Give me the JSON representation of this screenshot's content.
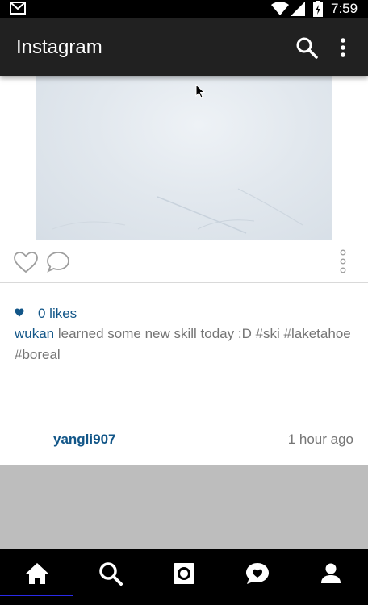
{
  "status_bar": {
    "time": "7:59",
    "icons": [
      "gmail-icon",
      "wifi-icon",
      "signal-icon",
      "battery-icon"
    ]
  },
  "app_bar": {
    "title": "Instagram",
    "icons": [
      "search-icon",
      "more-vert-icon"
    ]
  },
  "post": {
    "likes": "0 likes",
    "caption_user": "wukan",
    "caption_text": " learned some new skill today :D #ski #laketahoe #boreal",
    "actions": [
      "heart-outline-icon",
      "comment-icon",
      "more-vert-icon"
    ]
  },
  "comment": {
    "user": "yangli907",
    "time": "1 hour ago"
  },
  "bottom_nav": {
    "items": [
      "home-icon",
      "search-icon",
      "camera-icon",
      "activity-icon",
      "profile-icon"
    ],
    "active": "home-icon"
  },
  "colors": {
    "app_bar": "#212121",
    "link_blue": "#125688",
    "secondary_text": "#757575",
    "nav_indicator": "#2a2ae8"
  }
}
